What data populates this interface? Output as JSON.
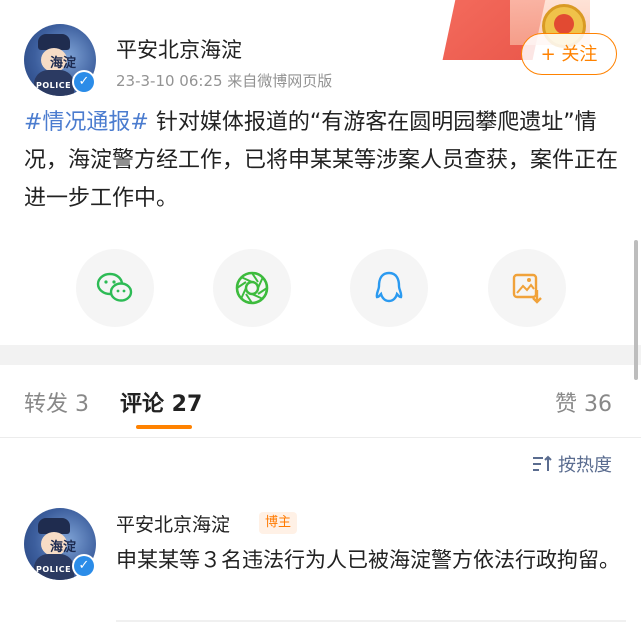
{
  "post": {
    "author_name": "平安北京海淀",
    "avatar_text": "海淀",
    "avatar_tag": "POLICE",
    "meta": "23-3-10 06:25 来自微博网页版",
    "follow_label": "+ 关注",
    "hashtag": "#情况通报#",
    "content": " 针对媒体报道的“有游客在圆明园攀爬遗址”情况，海淀警方经工作，已将申某某等涉案人员查获，案件正在进一步工作中。",
    "share_icons": [
      "wechat-icon",
      "moments-icon",
      "qq-icon",
      "save-image-icon"
    ]
  },
  "tabs": {
    "repost": "转发 3",
    "comment": "评论 27",
    "like": "赞 36"
  },
  "sort": {
    "label": "按热度",
    "icon": "sort-icon"
  },
  "comment": {
    "author_name": "平安北京海淀",
    "badge": "博主",
    "text": "申某某等３名违法行为人已被海淀警方依法行政拘留。"
  },
  "colors": {
    "accent": "#ff8200",
    "link": "#4b7ccf",
    "verified": "#2b8ce8"
  }
}
